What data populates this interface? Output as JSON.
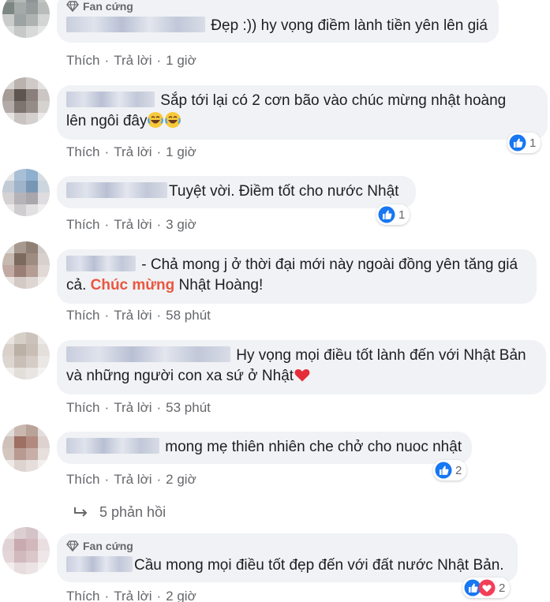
{
  "comments": [
    {
      "badge": "Fan cứng",
      "text": "Đẹp :)) hy vọng điềm lành tiền yên lên giá",
      "actions": {
        "like": "Thích",
        "reply": "Trả lời",
        "time": "1 giờ"
      },
      "reactions": null
    },
    {
      "text_line1": "Sắp tới lại có 2 cơn bão vào chúc mừng nhật hoàng",
      "text_line2": "lên ngôi đây",
      "emojis": [
        "laugh-cry-emoji",
        "laugh-cry-emoji"
      ],
      "actions": {
        "like": "Thích",
        "reply": "Trả lời",
        "time": "1 giờ"
      },
      "reactions": {
        "count": "1",
        "icons": [
          "like-icon"
        ]
      }
    },
    {
      "text": "Tuyệt vời. Điềm tốt cho nước Nhật",
      "actions": {
        "like": "Thích",
        "reply": "Trả lời",
        "time": "3 giờ"
      },
      "reactions": {
        "count": "1",
        "icons": [
          "like-icon"
        ]
      }
    },
    {
      "text_line1": "- Chả mong j ở thời đại mới này ngoài đồng yên tăng giá",
      "text_line2_pre": "cả. ",
      "text_line2_highlight": "Chúc mừng",
      "text_line2_post": " Nhật Hoàng!",
      "highlight_color": "#e9573f",
      "actions": {
        "like": "Thích",
        "reply": "Trả lời",
        "time": "58 phút"
      },
      "reactions": null
    },
    {
      "text_line1": "Hy vọng mọi điều tốt lành đến với Nhật Bản",
      "text_line2": "và những người con xa sứ ở Nhật",
      "emojis": [
        "red-heart-emoji"
      ],
      "actions": {
        "like": "Thích",
        "reply": "Trả lời",
        "time": "53 phút"
      },
      "reactions": null
    },
    {
      "text": "mong mẹ thiên nhiên che chở cho nuoc nhật",
      "actions": {
        "like": "Thích",
        "reply": "Trả lời",
        "time": "2 giờ"
      },
      "reactions": {
        "count": "2",
        "icons": [
          "like-icon"
        ]
      }
    },
    {
      "badge": "Fan cứng",
      "text": "Cầu mong mọi điều tốt đẹp đến với đất nước Nhật Bản.",
      "actions": {
        "like": "Thích",
        "reply": "Trả lời",
        "time": "2 giờ"
      },
      "reactions": {
        "count": "2",
        "icons": [
          "like-icon",
          "love-icon"
        ]
      }
    }
  ],
  "replies_link": {
    "label": "5 phản hồi",
    "icon": "reply-arrow-icon"
  },
  "colors": {
    "bubble_bg": "#f0f2f5",
    "secondary_text": "#65676b",
    "like_blue": "#1877f2",
    "love_red": "#f33e58"
  }
}
